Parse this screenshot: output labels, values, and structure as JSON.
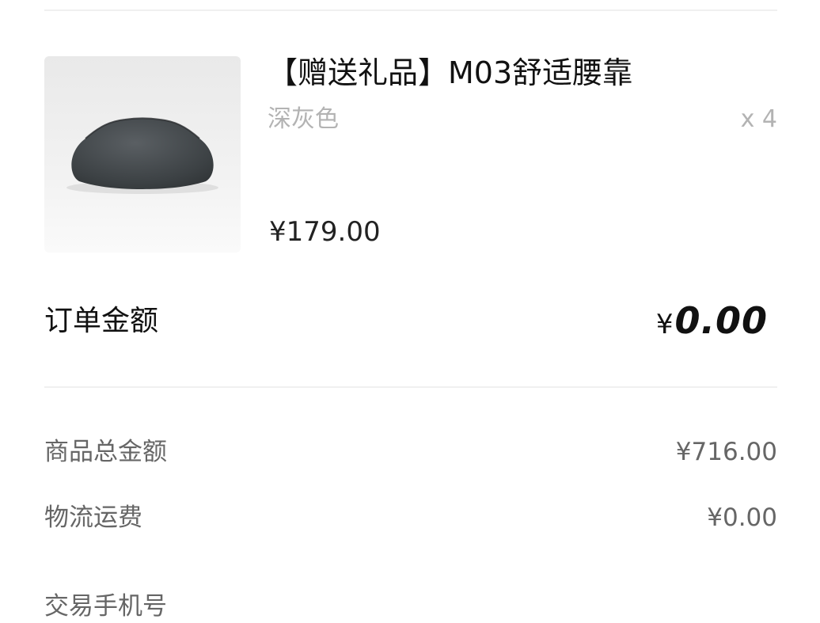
{
  "product": {
    "title": "【赠送礼品】M03舒适腰靠",
    "variant": "深灰色",
    "quantity": "x 4",
    "price": "¥179.00",
    "image_icon": "lumbar-pillow-photo"
  },
  "order_total": {
    "label": "订单金额",
    "currency": "¥",
    "amount": "0.00"
  },
  "summary": {
    "goods_total_label": "商品总金额",
    "goods_total_value": "¥716.00",
    "shipping_label": "物流运费",
    "shipping_value": "¥0.00",
    "phone_label": "交易手机号"
  },
  "colors": {
    "divider": "#f0f0f0",
    "muted_text": "#b3b3b3",
    "secondary_text": "#666666",
    "primary_text": "#111111"
  }
}
